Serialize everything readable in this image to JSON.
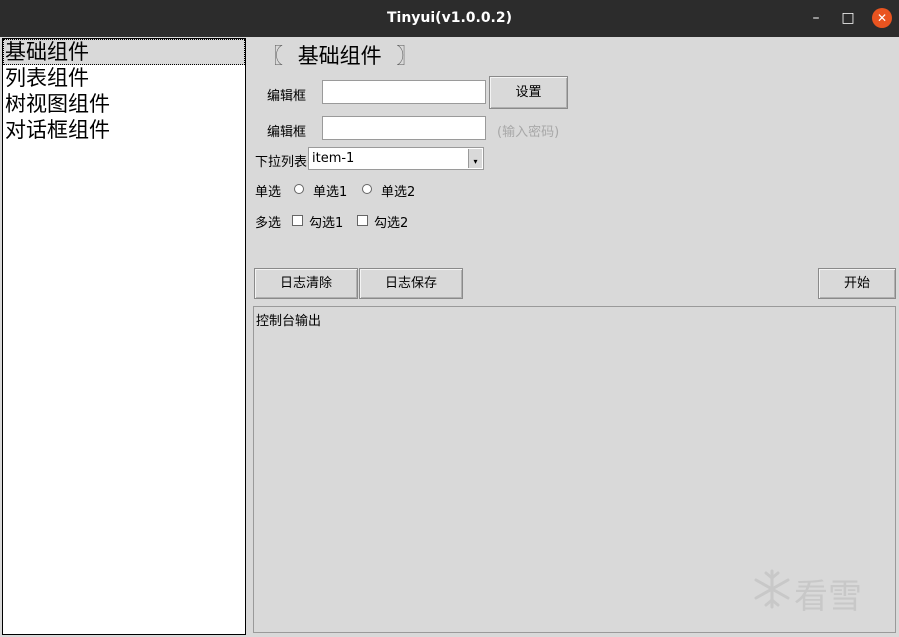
{
  "window": {
    "title": "Tinyui(v1.0.0.2)",
    "min": "–",
    "max": "□",
    "close": "✕"
  },
  "sidebar": {
    "items": [
      {
        "label": "基础组件",
        "selected": true
      },
      {
        "label": "列表组件",
        "selected": false
      },
      {
        "label": "树视图组件",
        "selected": false
      },
      {
        "label": "对话框组件",
        "selected": false
      }
    ]
  },
  "header": {
    "open": "〖",
    "title": "基础组件",
    "close": "〗"
  },
  "form": {
    "edit1": {
      "label": "编辑框",
      "value": ""
    },
    "set_button": "设置",
    "edit2": {
      "label": "编辑框",
      "value": "",
      "hint": "(输入密码)"
    },
    "combo": {
      "label": "下拉列表",
      "value": "item-1"
    },
    "radio": {
      "label": "单选",
      "options": [
        "单选1",
        "单选2"
      ]
    },
    "check": {
      "label": "多选",
      "options": [
        "勾选1",
        "勾选2"
      ]
    }
  },
  "actions": {
    "clear_log": "日志清除",
    "save_log": "日志保存",
    "start": "开始"
  },
  "console": {
    "text": "控制台输出"
  },
  "watermark": {
    "text": "看雪"
  },
  "colors": {
    "titlebar": "#2c2c2c",
    "close": "#e95420",
    "bg": "#d9d9d9"
  }
}
